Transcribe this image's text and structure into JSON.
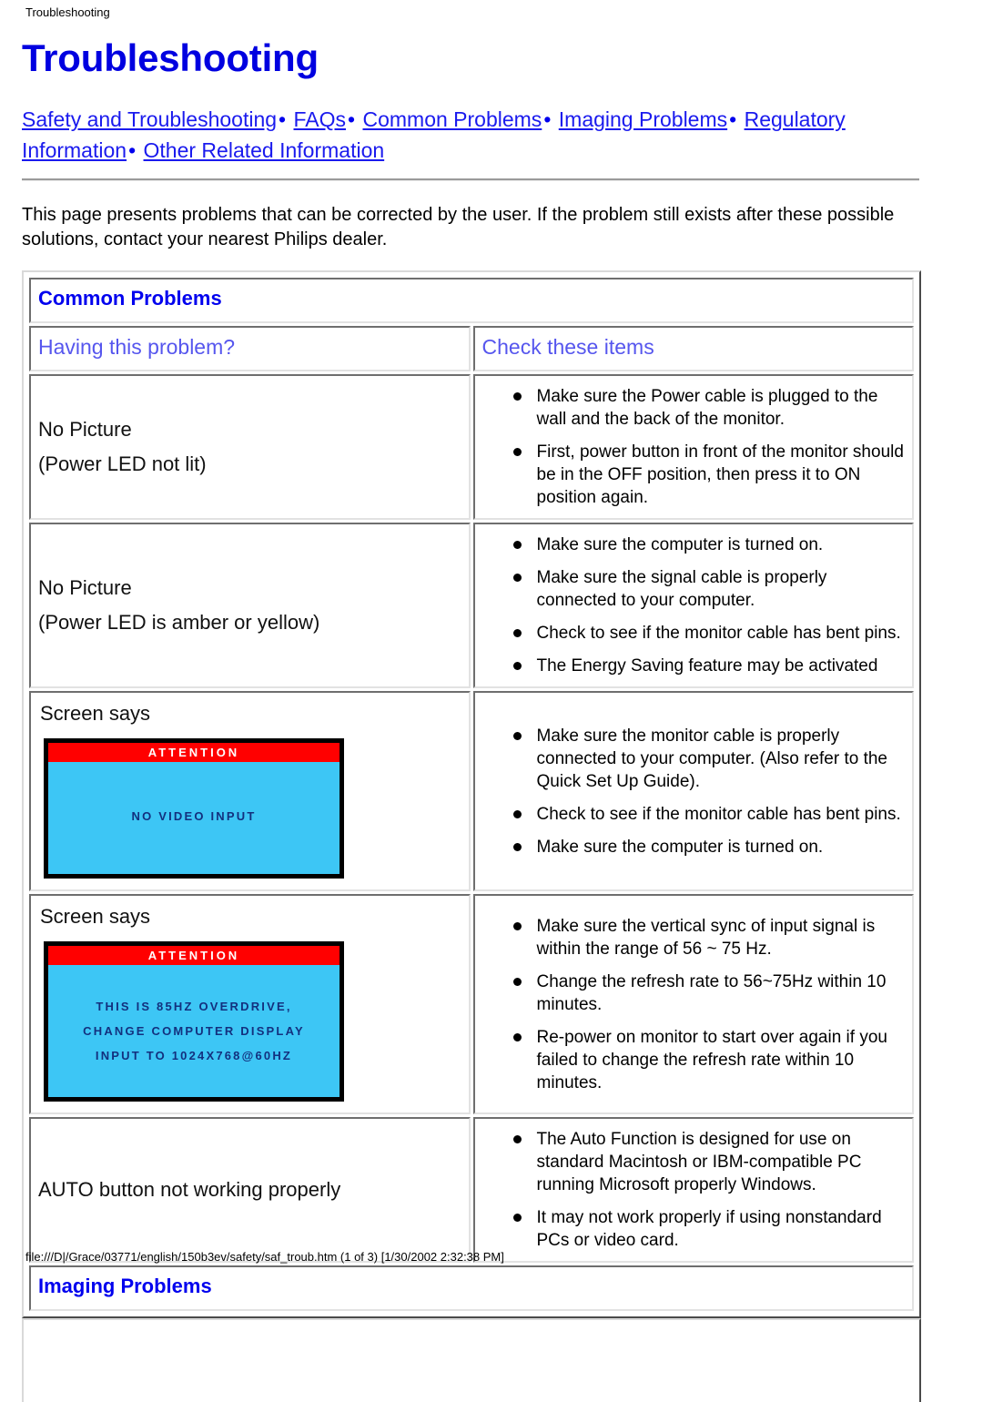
{
  "print_header": "Troubleshooting",
  "print_footer": "file:///D|/Grace/03771/english/150b3ev/safety/saf_troub.htm (1 of 3) [1/30/2002 2:32:38 PM]",
  "page_title": "Troubleshooting",
  "nav": {
    "separator": "•",
    "links": [
      "Safety and Troubleshooting",
      "FAQs",
      "Common Problems",
      "Imaging Problems",
      "Regulatory Information",
      "Other Related Information"
    ]
  },
  "intro": "This page presents problems that can be corrected by the user. If the problem still exists after these possible solutions, contact your nearest Philips dealer.",
  "table": {
    "section_title": "Common Problems",
    "headers": {
      "left": "Having this problem?",
      "right": "Check these items"
    },
    "rows": [
      {
        "problem_line1": "No Picture",
        "problem_line2": "(Power LED not lit)",
        "checks": [
          "Make sure the Power cable is plugged to the wall and the back of the monitor.",
          "First, power button in front of the monitor should be in the OFF position, then press it to ON position again."
        ]
      },
      {
        "problem_line1": "No Picture",
        "problem_line2": "(Power LED is amber or yellow)",
        "checks": [
          "Make sure the computer is turned on.",
          "Make sure the signal cable is properly connected to your computer.",
          "Check to see if the monitor cable has bent pins.",
          "The Energy Saving feature may be activated"
        ]
      },
      {
        "problem_line1": "Screen says",
        "osd": {
          "title": "ATTENTION",
          "lines": [
            "NO VIDEO INPUT"
          ]
        },
        "checks": [
          "Make sure the monitor cable is properly connected to your computer. (Also refer to the Quick Set Up Guide).",
          "Check to see if the monitor cable has bent pins.",
          "Make sure the computer is turned on."
        ]
      },
      {
        "problem_line1": "Screen says",
        "osd": {
          "title": "ATTENTION",
          "lines": [
            "THIS IS 85HZ OVERDRIVE,",
            "CHANGE COMPUTER DISPLAY",
            "INPUT TO 1024X768@60HZ"
          ]
        },
        "checks": [
          "Make sure the vertical sync of input signal is within the range of 56 ~ 75 Hz.",
          "Change the refresh rate to 56~75Hz within 10 minutes.",
          "Re-power on monitor to start over again if you failed to change the refresh rate within 10 minutes."
        ]
      },
      {
        "problem_line1": "AUTO button not working properly",
        "checks": [
          "The Auto Function is designed for use on standard Macintosh or IBM-compatible PC running Microsoft properly Windows.",
          "It may not work properly if using nonstandard PCs or video card."
        ]
      }
    ],
    "next_section_title": "Imaging Problems"
  },
  "colors": {
    "heading_blue": "#0000e0",
    "link_blue": "#1a1aee",
    "column_head_blue": "#5656ee",
    "osd_title_bg": "#ff0000",
    "osd_body_bg": "#3dc6f5",
    "osd_text": "#13307e"
  }
}
